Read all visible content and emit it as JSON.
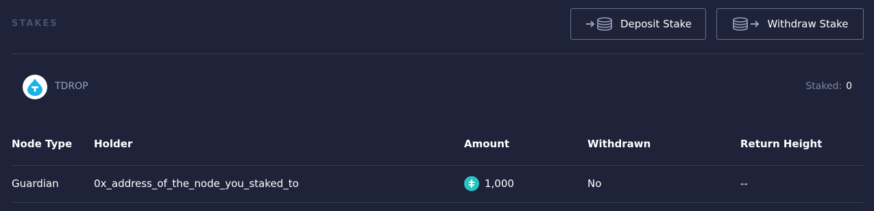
{
  "header": {
    "section_title": "STAKES",
    "deposit_label": "Deposit Stake",
    "withdraw_label": "Withdraw Stake"
  },
  "token": {
    "name": "TDROP",
    "logo_icon": "tdrop-logo-icon",
    "staked_label": "Staked:",
    "staked_value": "0"
  },
  "table": {
    "columns": [
      "Node Type",
      "Holder",
      "Amount",
      "Withdrawn",
      "Return Height"
    ],
    "rows": [
      {
        "node_type": "Guardian",
        "holder": "0x_address_of_the_node_you_staked_to",
        "amount": "1,000",
        "amount_icon": "theta-coin-icon",
        "withdrawn": "No",
        "return_height": "--"
      }
    ]
  },
  "colors": {
    "background": "#1f2339",
    "border": "#6a7090",
    "accent": "#29c2c2",
    "tdrop": "#1ab3e6"
  }
}
